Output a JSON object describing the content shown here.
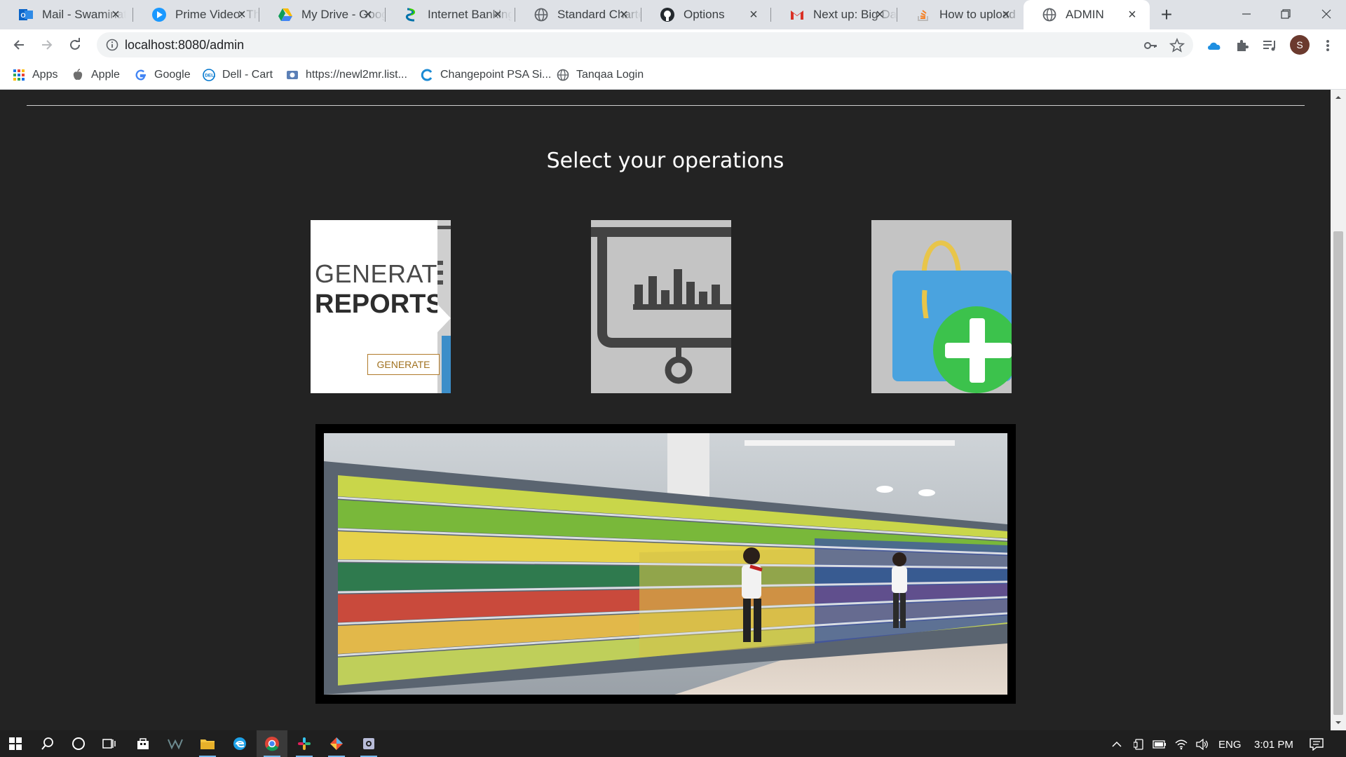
{
  "tabs": [
    {
      "title": "Mail - Swaminathan",
      "icon": "outlook-icon"
    },
    {
      "title": "Prime Video: The",
      "icon": "prime-video-icon"
    },
    {
      "title": "My Drive - Google",
      "icon": "google-drive-icon"
    },
    {
      "title": "Internet Banking",
      "icon": "standard-chartered-icon"
    },
    {
      "title": "Standard Chartered",
      "icon": "globe-icon"
    },
    {
      "title": "Options",
      "icon": "github-icon"
    },
    {
      "title": "Next up: Big Data",
      "icon": "gmail-icon"
    },
    {
      "title": "How to upload",
      "icon": "stackoverflow-icon"
    },
    {
      "title": "ADMIN",
      "icon": "globe-icon",
      "active": true
    }
  ],
  "address_bar": {
    "url": "localhost:8080/admin"
  },
  "bookmarks": [
    {
      "label": "Apps",
      "icon": "apps-grid-icon"
    },
    {
      "label": "Apple",
      "icon": "apple-icon"
    },
    {
      "label": "Google",
      "icon": "google-icon"
    },
    {
      "label": "Dell - Cart",
      "icon": "dell-icon"
    },
    {
      "label": "https://newl2mr.list...",
      "icon": "web-icon"
    },
    {
      "label": "Changepoint PSA Si...",
      "icon": "changepoint-icon"
    },
    {
      "label": "Tanqaa Login",
      "icon": "globe-icon"
    }
  ],
  "profile": {
    "initial": "S"
  },
  "page": {
    "heading": "Select your operations",
    "operations": [
      {
        "id": "generate-reports",
        "title_line1": "GENERATE",
        "title_line2": "REPORTS",
        "button": "GENERATE"
      },
      {
        "id": "analytics",
        "icon": "presentation-chart-icon"
      },
      {
        "id": "add-product",
        "icon": "shopping-bag-add-icon"
      }
    ],
    "banner_image": "supermarket-shelves-photo"
  },
  "taskbar": {
    "apps": [
      "windows-start-icon",
      "search-icon",
      "cortana-icon",
      "task-view-icon",
      "store-icon",
      "app-icon",
      "file-explorer-icon",
      "edge-icon",
      "chrome-icon",
      "slack-icon",
      "git-icon",
      "settings-app-icon"
    ],
    "language": "ENG",
    "time": "3:01 PM"
  },
  "colors": {
    "page_bg": "#232323",
    "tab_bg": "#dee1e6",
    "card_grey": "#c4c4c4",
    "accent_gold": "#b07a2a",
    "bag_blue": "#4aa3df",
    "plus_green": "#3cc24c"
  }
}
